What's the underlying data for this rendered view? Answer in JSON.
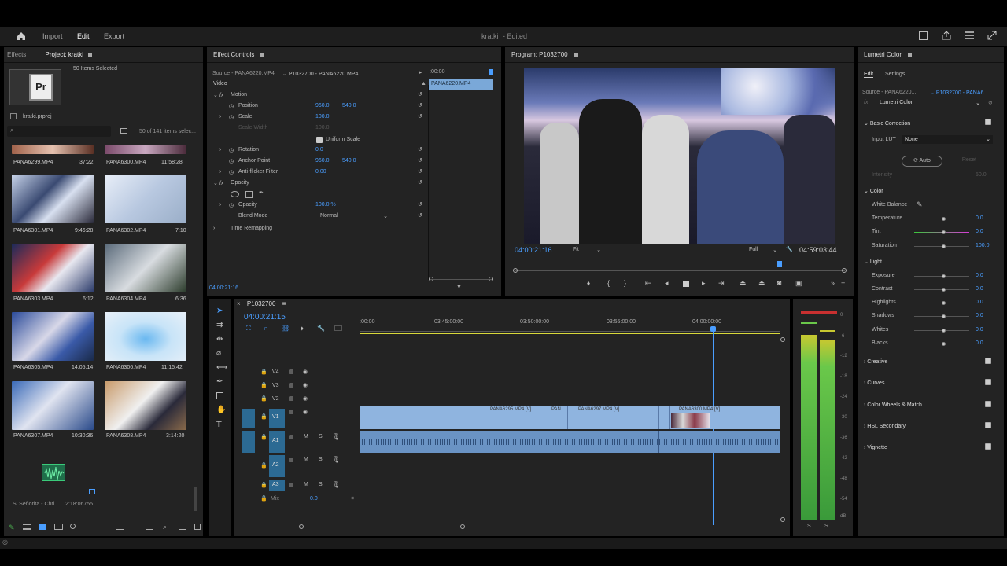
{
  "header": {
    "menu": [
      "Import",
      "Edit",
      "Export"
    ],
    "active_menu": "Edit",
    "title": "kratki",
    "status": "- Edited"
  },
  "project_panel": {
    "tabs": [
      "Effects",
      "Project: kratki"
    ],
    "items_selected": "50 Items Selected",
    "project_file": "kratki.prproj",
    "count": "50 of 141 items selec...",
    "top_row": [
      {
        "name": "PANA6299.MP4",
        "duration": "37:22"
      },
      {
        "name": "PANA6300.MP4",
        "duration": "11:58:28"
      }
    ],
    "clips": [
      {
        "name": "PANA6301.MP4",
        "duration": "9:46:28"
      },
      {
        "name": "PANA6302.MP4",
        "duration": "7:10"
      },
      {
        "name": "PANA6303.MP4",
        "duration": "6:12"
      },
      {
        "name": "PANA6304.MP4",
        "duration": "6:36"
      },
      {
        "name": "PANA6305.MP4",
        "duration": "14:05:14"
      },
      {
        "name": "PANA6306.MP4",
        "duration": "11:15:42"
      },
      {
        "name": "PANA6307.MP4",
        "duration": "10:30:36"
      },
      {
        "name": "PANA6308.MP4",
        "duration": "3:14:20"
      }
    ],
    "audio_item": {
      "name": "Si Señorita - Chri...",
      "duration": "2:18:06755"
    }
  },
  "effect_controls": {
    "tab": "Effect Controls",
    "source": "Source - PANA6220.MP4",
    "sequence_clip": "P1032700 - PANA6220.MP4",
    "timecode_top": ":00:00",
    "clip_bar": "PANA6220.MP4",
    "section_video": "Video",
    "motion": "Motion",
    "position_label": "Position",
    "position_x": "960.0",
    "position_y": "540.0",
    "scale_label": "Scale",
    "scale_value": "100.0",
    "scale_width_label": "Scale Width",
    "scale_width_value": "100.0",
    "uniform_scale": "Uniform Scale",
    "rotation_label": "Rotation",
    "rotation_value": "0.0",
    "anchor_label": "Anchor Point",
    "anchor_x": "960.0",
    "anchor_y": "540.0",
    "antiflicker_label": "Anti-flicker Filter",
    "antiflicker_value": "0.00",
    "opacity_section": "Opacity",
    "opacity_label": "Opacity",
    "opacity_value": "100.0 %",
    "blend_label": "Blend Mode",
    "blend_value": "Normal",
    "time_remap": "Time Remapping",
    "timecode_bottom": "04:00:21:16"
  },
  "program_monitor": {
    "tab": "Program: P1032700",
    "timecode": "04:00:21:16",
    "fit": "Fit",
    "quality": "Full",
    "duration": "04:59:03:44"
  },
  "timeline": {
    "tab": "P1032700",
    "timecode": "04:00:21:15",
    "ruler": [
      ":00:00",
      "03:45:00:00",
      "03:50:00:00",
      "03:55:00:00",
      "04:00:00:00"
    ],
    "video_tracks": [
      "V4",
      "V3",
      "V2",
      "V1"
    ],
    "audio_tracks": [
      "A1",
      "A2",
      "A3"
    ],
    "mix_label": "Mix",
    "mix_value": "0.0",
    "clip_labels": [
      "PANA6295.MP4 [V]",
      "PAN",
      "PANA6297.MP4 [V]",
      "PANA6300.MP4 [V]"
    ]
  },
  "meter": {
    "scale": [
      "0",
      "-6",
      "-12",
      "-18",
      "-24",
      "-30",
      "-36",
      "-42",
      "-48",
      "-54",
      "dB"
    ],
    "solo": [
      "S",
      "S"
    ]
  },
  "lumetri": {
    "title": "Lumetri Color",
    "tabs": [
      "Edit",
      "Settings"
    ],
    "source": "Source - PANA6220...",
    "sequence": "P1032700 - PANA6...",
    "effect": "Lumetri Color",
    "basic_correction": "Basic Correction",
    "input_lut_label": "Input LUT",
    "input_lut_value": "None",
    "auto": "Auto",
    "reset": "Reset",
    "intensity_label": "Intensity",
    "intensity_value": "50.0",
    "color_section": "Color",
    "white_balance": "White Balance",
    "temperature": {
      "label": "Temperature",
      "value": "0.0"
    },
    "tint": {
      "label": "Tint",
      "value": "0.0"
    },
    "saturation": {
      "label": "Saturation",
      "value": "100.0"
    },
    "light_section": "Light",
    "light": [
      {
        "label": "Exposure",
        "value": "0.0"
      },
      {
        "label": "Contrast",
        "value": "0.0"
      },
      {
        "label": "Highlights",
        "value": "0.0"
      },
      {
        "label": "Shadows",
        "value": "0.0"
      },
      {
        "label": "Whites",
        "value": "0.0"
      },
      {
        "label": "Blacks",
        "value": "0.0"
      }
    ],
    "sections": [
      "Creative",
      "Curves",
      "Color Wheels & Match",
      "HSL Secondary",
      "Vignette"
    ]
  },
  "colors": {
    "accent": "#4a9eff",
    "panel": "#232323",
    "clip_video": "#8fb4df",
    "track_blue": "#2c6a93",
    "playhead": "#4a9eff"
  }
}
